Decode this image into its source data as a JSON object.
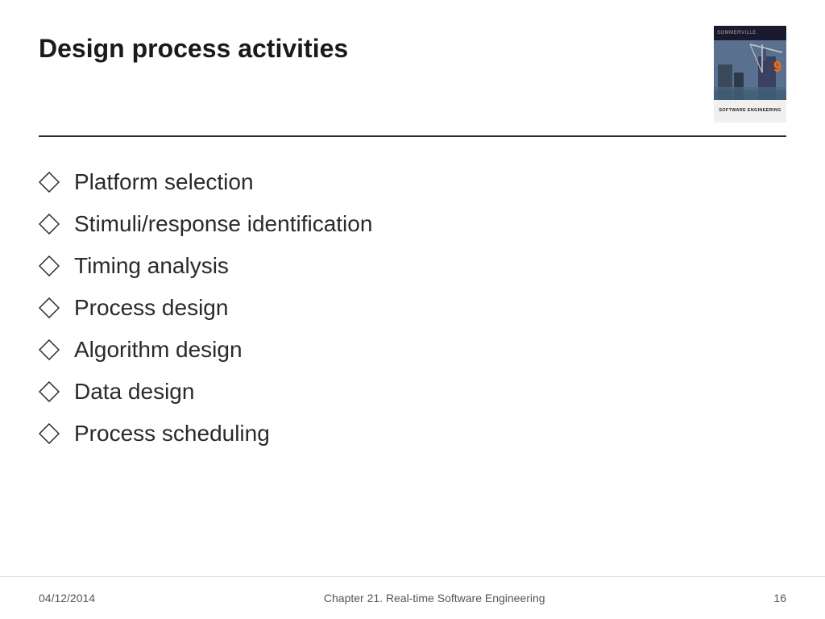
{
  "slide": {
    "title": "Design process activities",
    "bullets": [
      {
        "text": "Platform selection"
      },
      {
        "text": "Stimuli/response identification"
      },
      {
        "text": "Timing analysis"
      },
      {
        "text": "Process design"
      },
      {
        "text": "Algorithm design"
      },
      {
        "text": "Data design"
      },
      {
        "text": "Process scheduling"
      }
    ],
    "footer": {
      "date": "04/12/2014",
      "chapter": "Chapter 21. Real-time Software Engineering",
      "page": "16"
    },
    "book": {
      "top_label": "SOMMERVILLE",
      "title_line1": "SOFTWARE ENGINEERING",
      "edition": "9"
    }
  }
}
